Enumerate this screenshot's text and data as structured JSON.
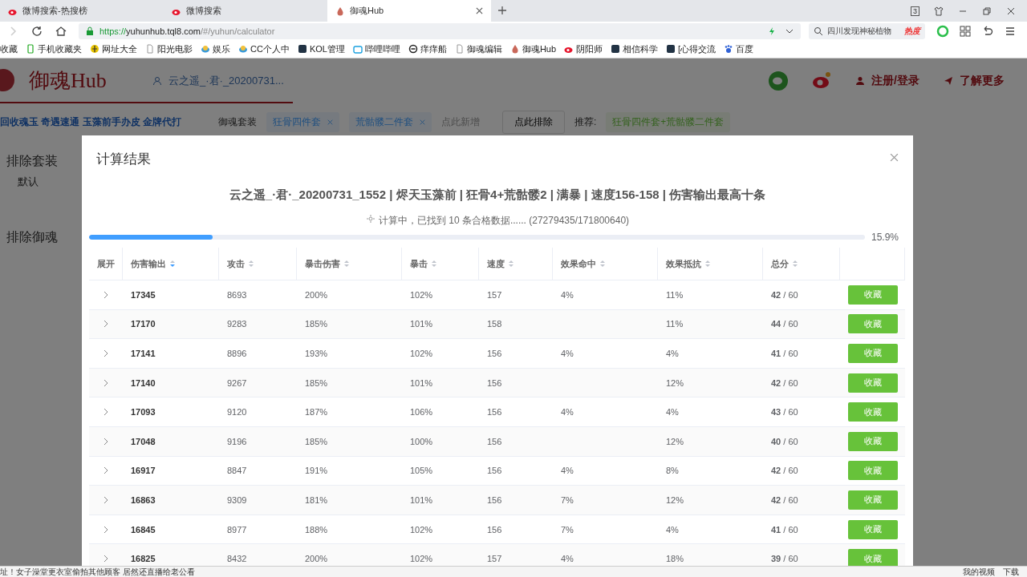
{
  "browser": {
    "tabs": [
      {
        "label": "微博搜索-热搜榜",
        "kind": "weibo",
        "selected": false
      },
      {
        "label": "微博搜索",
        "kind": "weibo",
        "selected": false
      },
      {
        "label": "御魂Hub",
        "kind": "drop",
        "selected": true
      }
    ],
    "tab_count": "3",
    "url": {
      "scheme": "https://",
      "host": "yuhunhub.tql8.com",
      "path": "/#/yuhun/calculator"
    },
    "search": {
      "value": "四川发现神秘植物",
      "badge": "热度"
    },
    "bookmarks": [
      {
        "label": "收藏",
        "kind": "none"
      },
      {
        "label": "手机收藏夹",
        "kind": "phone"
      },
      {
        "label": "网址大全",
        "kind": "globe"
      },
      {
        "label": "阳光电影",
        "kind": "page"
      },
      {
        "label": "娱乐",
        "kind": "cloud"
      },
      {
        "label": "CC个人中",
        "kind": "cloud"
      },
      {
        "label": "KOL管理",
        "kind": "square"
      },
      {
        "label": "哔哩哔哩",
        "kind": "tv"
      },
      {
        "label": "痒痒船",
        "kind": "ring"
      },
      {
        "label": "御魂编辑",
        "kind": "page"
      },
      {
        "label": "御魂Hub",
        "kind": "drop"
      },
      {
        "label": "阴阳师",
        "kind": "weibo"
      },
      {
        "label": "相信科学",
        "kind": "square"
      },
      {
        "label": "[心得交流",
        "kind": "square"
      },
      {
        "label": "百度",
        "kind": "paw"
      }
    ]
  },
  "site": {
    "logo": "御魂Hub",
    "user": "云之遥_·君·_20200731...",
    "register": "注册/登录",
    "more": "了解更多",
    "promo": "回收魂玉 奇遇速通 玉藻前手办皮 金牌代打",
    "set_label": "御魂套装",
    "set_tags": [
      "狂骨四件套",
      "荒骷髅二件套"
    ],
    "add_placeholder": "点此新增",
    "exclude_button": "点此排除",
    "recommend_label": "推荐:",
    "recommend_tag": "狂骨四件套+荒骷髅二件套",
    "sidebar": {
      "exclude_sets": "排除套装",
      "folder": "默认",
      "exclude_yuhun": "排除御魂"
    }
  },
  "modal": {
    "title": "计算结果",
    "heading": "云之遥_·君·_20200731_1552 | 烬天玉藻前 | 狂骨4+荒骷髅2 | 满暴 | 速度156-158 | 伤害输出最高十条",
    "status": "计算中，已找到 10 条合格数据...... (27279435/171800640)",
    "progress": {
      "level": 0.159,
      "reading": "15.9%"
    },
    "table": {
      "expand_label": "展开",
      "columns": [
        {
          "label": "伤害输出",
          "sorted": true
        },
        {
          "label": "攻击",
          "sorted": false
        },
        {
          "label": "暴击伤害",
          "sorted": false
        },
        {
          "label": "暴击",
          "sorted": false
        },
        {
          "label": "速度",
          "sorted": false
        },
        {
          "label": "效果命中",
          "sorted": false
        },
        {
          "label": "效果抵抗",
          "sorted": false
        },
        {
          "label": "总分",
          "sorted": false
        }
      ],
      "rows": [
        {
          "expanded": false,
          "cells": [
            "17345",
            "8693",
            "200%",
            "102%",
            "157",
            "4%",
            "11%",
            "**42** / 60"
          ],
          "action": "收藏"
        },
        {
          "expanded": false,
          "cells": [
            "17170",
            "9283",
            "185%",
            "101%",
            "158",
            null,
            "11%",
            "**44** / 60"
          ],
          "action": "收藏"
        },
        {
          "expanded": false,
          "cells": [
            "17141",
            "8896",
            "193%",
            "102%",
            "156",
            "4%",
            "4%",
            "**41** / 60"
          ],
          "action": "收藏"
        },
        {
          "expanded": false,
          "cells": [
            "17140",
            "9267",
            "185%",
            "101%",
            "156",
            null,
            "12%",
            "**42** / 60"
          ],
          "action": "收藏"
        },
        {
          "expanded": false,
          "cells": [
            "17093",
            "9120",
            "187%",
            "106%",
            "156",
            "4%",
            "4%",
            "**43** / 60"
          ],
          "action": "收藏"
        },
        {
          "expanded": false,
          "cells": [
            "17048",
            "9196",
            "185%",
            "100%",
            "156",
            null,
            "12%",
            "**40** / 60"
          ],
          "action": "收藏"
        },
        {
          "expanded": false,
          "cells": [
            "16917",
            "8847",
            "191%",
            "105%",
            "156",
            "4%",
            "8%",
            "**42** / 60"
          ],
          "action": "收藏"
        },
        {
          "expanded": false,
          "cells": [
            "16863",
            "9309",
            "181%",
            "101%",
            "156",
            "7%",
            "12%",
            "**42** / 60"
          ],
          "action": "收藏"
        },
        {
          "expanded": false,
          "cells": [
            "16845",
            "8977",
            "188%",
            "102%",
            "156",
            "7%",
            "4%",
            "**41** / 60"
          ],
          "action": "收藏"
        },
        {
          "expanded": false,
          "cells": [
            "16825",
            "8432",
            "200%",
            "102%",
            "157",
            "4%",
            "18%",
            "**39** / 60"
          ],
          "action": "收藏"
        }
      ]
    }
  },
  "status_bar": {
    "news": "址！女子澡堂更衣室偷拍其他顾客 居然还直播给老公看",
    "video": "我的视频",
    "download": "下载"
  }
}
